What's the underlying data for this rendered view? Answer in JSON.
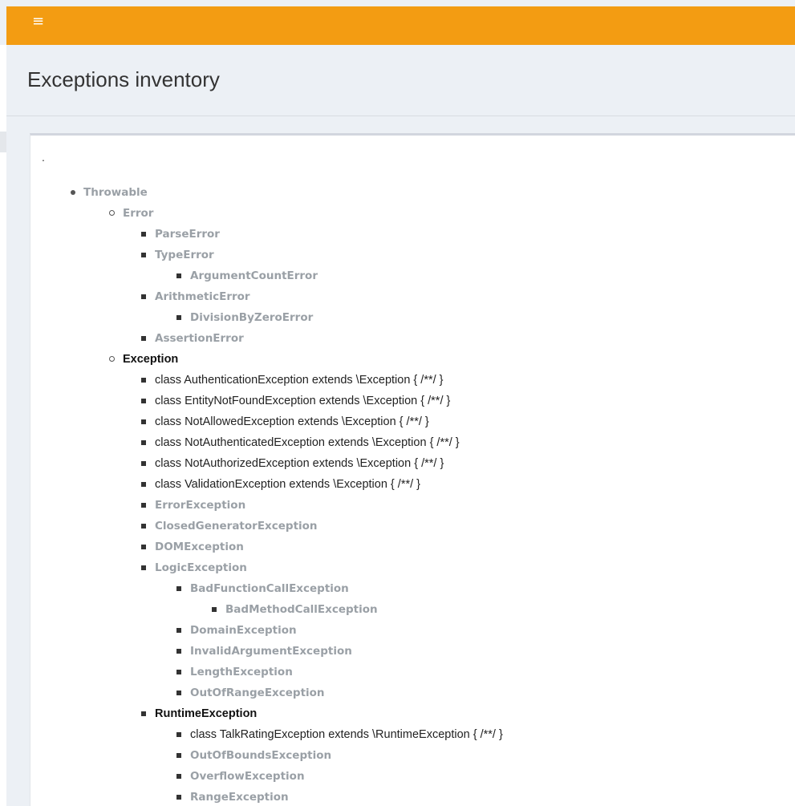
{
  "topbar": {
    "menu_icon": "hamburger-menu-icon",
    "menu_glyph": "≡",
    "accent_color": "#f39c12"
  },
  "header": {
    "title": "Exceptions inventory"
  },
  "content": {
    "dot": "."
  },
  "tree": [
    {
      "label": "Throwable",
      "style": "builtin",
      "bullet": "disc"
    },
    {
      "label": "Error",
      "style": "builtin",
      "bullet": "circle"
    },
    {
      "label": "ParseError",
      "style": "builtin",
      "bullet": "square"
    },
    {
      "label": "TypeError",
      "style": "builtin",
      "bullet": "square"
    },
    {
      "label": "ArgumentCountError",
      "style": "builtin",
      "bullet": "square"
    },
    {
      "label": "ArithmeticError",
      "style": "builtin",
      "bullet": "square"
    },
    {
      "label": "DivisionByZeroError",
      "style": "builtin",
      "bullet": "square"
    },
    {
      "label": "AssertionError",
      "style": "builtin",
      "bullet": "square"
    },
    {
      "label": "Exception",
      "style": "highlight",
      "bullet": "circle"
    },
    {
      "label": "class AuthenticationException extends \\Exception { /**/ }",
      "style": "custom",
      "bullet": "square"
    },
    {
      "label": "class EntityNotFoundException extends \\Exception { /**/ }",
      "style": "custom",
      "bullet": "square"
    },
    {
      "label": "class NotAllowedException extends \\Exception { /**/ }",
      "style": "custom",
      "bullet": "square"
    },
    {
      "label": "class NotAuthenticatedException extends \\Exception { /**/ }",
      "style": "custom",
      "bullet": "square"
    },
    {
      "label": "class NotAuthorizedException extends \\Exception { /**/ }",
      "style": "custom",
      "bullet": "square"
    },
    {
      "label": "class ValidationException extends \\Exception { /**/ }",
      "style": "custom",
      "bullet": "square"
    },
    {
      "label": "ErrorException",
      "style": "builtin",
      "bullet": "square"
    },
    {
      "label": "ClosedGeneratorException",
      "style": "builtin",
      "bullet": "square"
    },
    {
      "label": "DOMException",
      "style": "builtin",
      "bullet": "square"
    },
    {
      "label": "LogicException",
      "style": "builtin",
      "bullet": "square"
    },
    {
      "label": "BadFunctionCallException",
      "style": "builtin",
      "bullet": "square"
    },
    {
      "label": "BadMethodCallException",
      "style": "builtin",
      "bullet": "square"
    },
    {
      "label": "DomainException",
      "style": "builtin",
      "bullet": "square"
    },
    {
      "label": "InvalidArgumentException",
      "style": "builtin",
      "bullet": "square"
    },
    {
      "label": "LengthException",
      "style": "builtin",
      "bullet": "square"
    },
    {
      "label": "OutOfRangeException",
      "style": "builtin",
      "bullet": "square"
    },
    {
      "label": "RuntimeException",
      "style": "highlight",
      "bullet": "square"
    },
    {
      "label": "class TalkRatingException extends \\RuntimeException { /**/ }",
      "style": "custom",
      "bullet": "square"
    },
    {
      "label": "OutOfBoundsException",
      "style": "builtin",
      "bullet": "square"
    },
    {
      "label": "OverflowException",
      "style": "builtin",
      "bullet": "square"
    },
    {
      "label": "RangeException",
      "style": "builtin",
      "bullet": "square"
    }
  ]
}
